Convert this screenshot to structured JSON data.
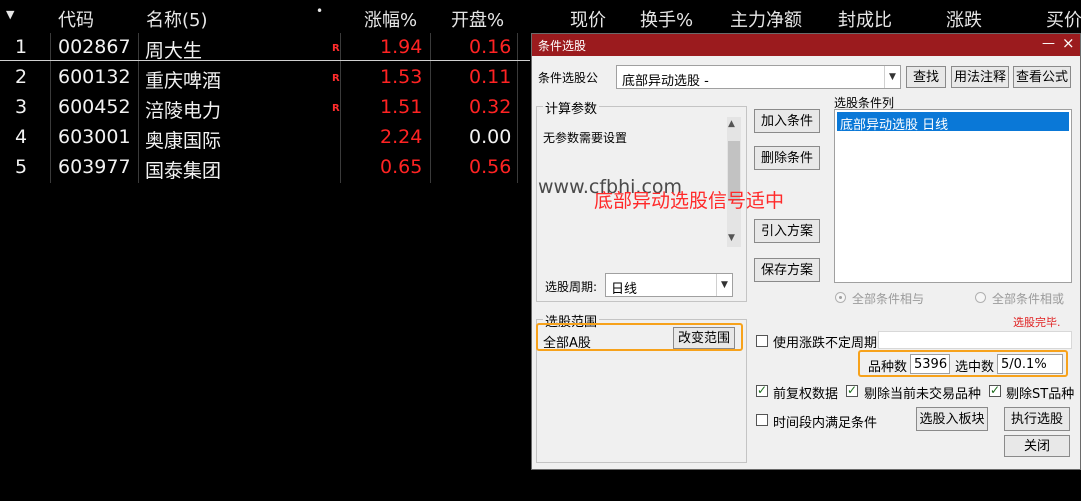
{
  "table": {
    "headers": {
      "code": "代码",
      "name": "名称(5)",
      "dot": "•",
      "change_pct": "涨幅%",
      "open_pct": "开盘%",
      "price": "现价",
      "turnover": "换手%",
      "main_net": "主力净额",
      "seal_ratio": "封成比",
      "change": "涨跌",
      "buy": "买价"
    },
    "rows": [
      {
        "idx": "1",
        "code": "002867",
        "name": "周大生",
        "flag": "R",
        "change_pct": "1.94",
        "open_pct": "0.16"
      },
      {
        "idx": "2",
        "code": "600132",
        "name": "重庆啤酒",
        "flag": "R",
        "change_pct": "1.53",
        "open_pct": "0.11"
      },
      {
        "idx": "3",
        "code": "600452",
        "name": "涪陵电力",
        "flag": "R",
        "change_pct": "1.51",
        "open_pct": "0.32"
      },
      {
        "idx": "4",
        "code": "603001",
        "name": "奥康国际",
        "flag": "",
        "change_pct": "2.24",
        "open_pct": "0.00"
      },
      {
        "idx": "5",
        "code": "603977",
        "name": "国泰集团",
        "flag": "",
        "change_pct": "0.65",
        "open_pct": "0.56"
      }
    ]
  },
  "dialog": {
    "title": "条件选股",
    "title_buttons": {
      "min": "—",
      "close": "×"
    },
    "formula_label": "条件选股公",
    "formula_value": "底部异动选股  -",
    "btn_find": "查找",
    "btn_usage": "用法注释",
    "btn_view": "查看公式",
    "params_group": "计算参数",
    "params_text": "无参数需要设置",
    "btn_add": "加入条件",
    "btn_delete": "删除条件",
    "btn_import": "引入方案",
    "btn_save": "保存方案",
    "cond_list_label": "选股条件列",
    "cond_list_items": [
      "底部异动选股  日线"
    ],
    "period_label": "选股周期:",
    "period_value": "日线",
    "radio_and": "全部条件相与",
    "radio_or": "全部条件相或",
    "done_text": "选股完毕.",
    "scope_group": "选股范围",
    "scope_value": "全部A股",
    "btn_change_scope": "改变范围",
    "use_period_label": "使用涨跌不定周期",
    "count_label": "品种数",
    "count_value": "5396",
    "selected_label": "选中数",
    "selected_value": "5/0.1%",
    "chk_fq": "前复权数据",
    "chk_exclude_notrade": "剔除当前未交易品种",
    "chk_exclude_st": "剔除ST品种",
    "chk_period_within": "时间段内满足条件",
    "btn_to_block": "选股入板块",
    "btn_execute": "执行选股",
    "btn_close": "关闭"
  },
  "overlay": {
    "watermark": "www.cfbhi.com",
    "signal_text": "底部异动选股信号适中"
  },
  "colors": {
    "up_red": "#ff2323",
    "title_bar": "#9b1b1e",
    "highlight_orange": "#f7a21b",
    "selection_blue": "#0a78d7"
  }
}
